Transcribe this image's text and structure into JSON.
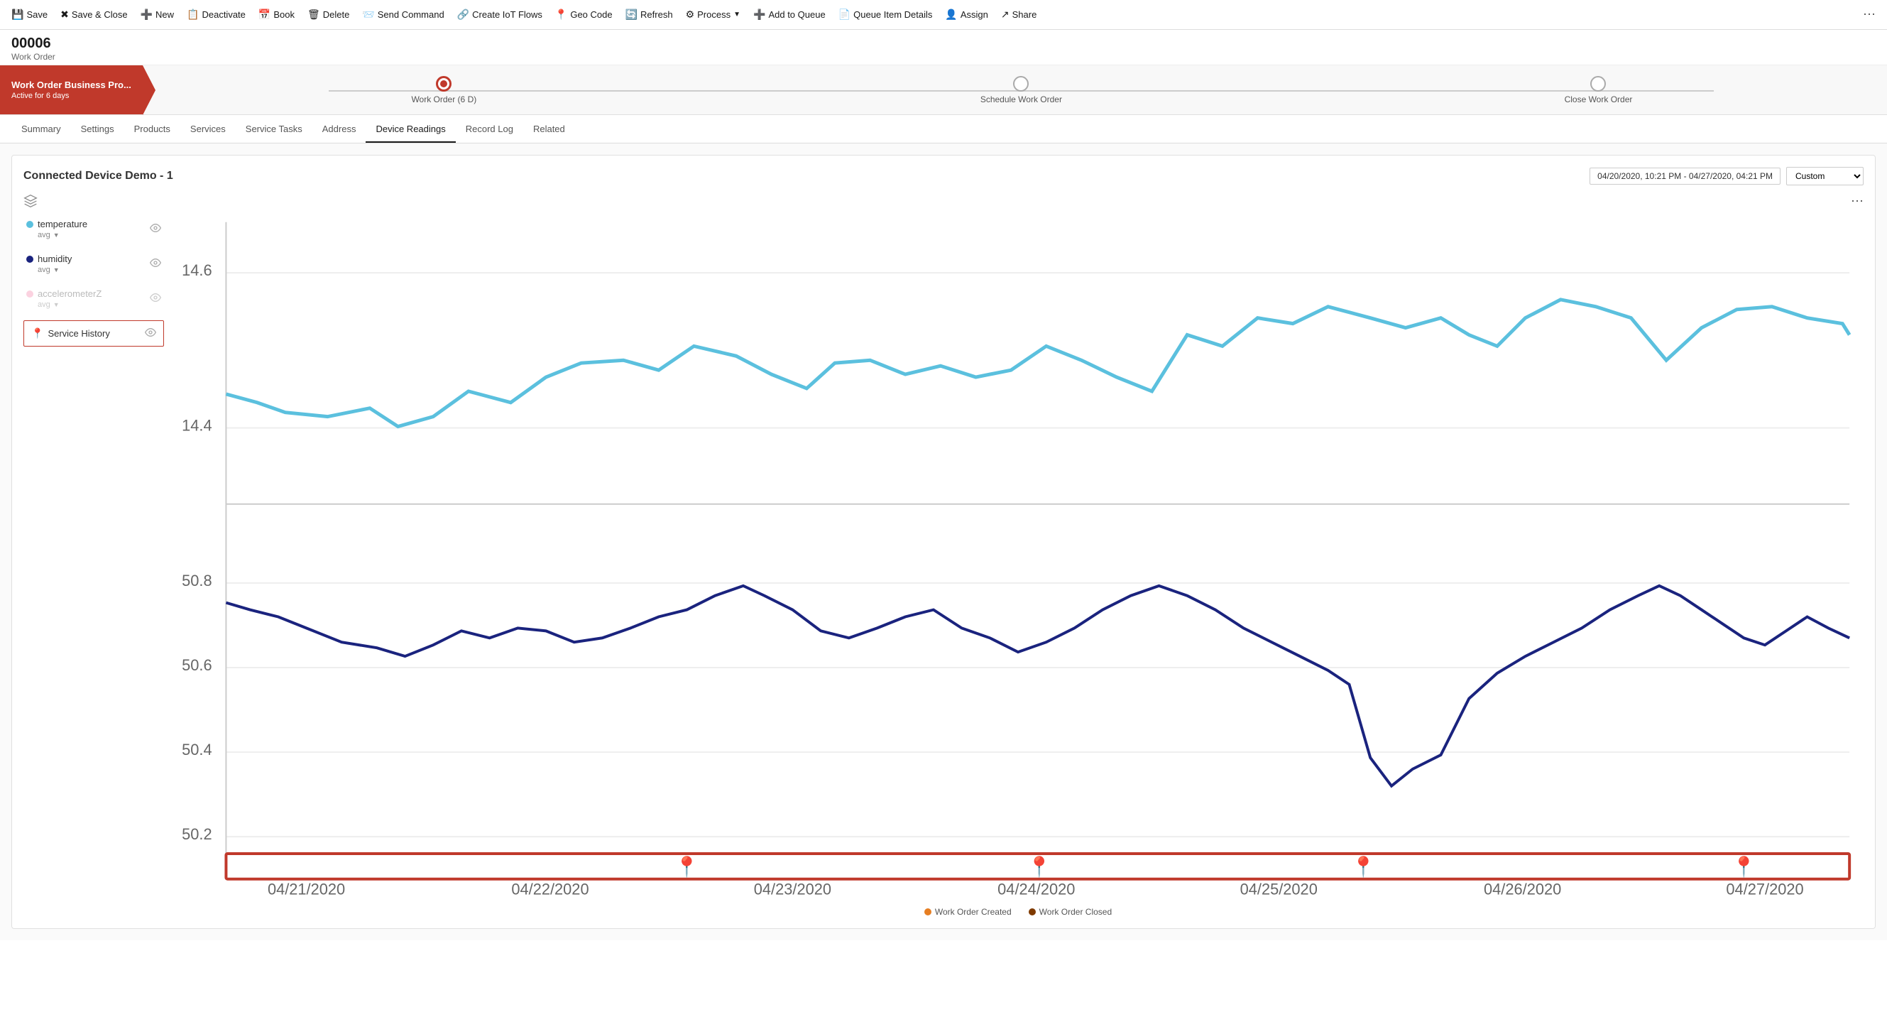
{
  "toolbar": {
    "save_label": "Save",
    "save_close_label": "Save & Close",
    "new_label": "New",
    "deactivate_label": "Deactivate",
    "book_label": "Book",
    "delete_label": "Delete",
    "send_command_label": "Send Command",
    "create_iot_flows_label": "Create IoT Flows",
    "geo_code_label": "Geo Code",
    "refresh_label": "Refresh",
    "process_label": "Process",
    "add_to_queue_label": "Add to Queue",
    "queue_item_details_label": "Queue Item Details",
    "assign_label": "Assign",
    "share_label": "Share"
  },
  "record": {
    "id": "00006",
    "type": "Work Order"
  },
  "stage": {
    "active_name": "Work Order Business Pro...",
    "active_sub": "Active for 6 days",
    "steps": [
      {
        "label": "Work Order (6 D)",
        "state": "active"
      },
      {
        "label": "Schedule Work Order",
        "state": "inactive"
      },
      {
        "label": "Close Work Order",
        "state": "inactive"
      }
    ]
  },
  "nav_tabs": {
    "tabs": [
      {
        "label": "Summary",
        "active": false
      },
      {
        "label": "Settings",
        "active": false
      },
      {
        "label": "Products",
        "active": false
      },
      {
        "label": "Services",
        "active": false
      },
      {
        "label": "Service Tasks",
        "active": false
      },
      {
        "label": "Address",
        "active": false
      },
      {
        "label": "Device Readings",
        "active": true
      },
      {
        "label": "Record Log",
        "active": false
      },
      {
        "label": "Related",
        "active": false
      }
    ]
  },
  "readings_card": {
    "title": "Connected Device Demo - 1",
    "date_range": "04/20/2020, 10:21 PM - 04/27/2020, 04:21 PM",
    "custom_option": "Custom",
    "legend_items": [
      {
        "id": "temperature",
        "label": "temperature",
        "sub": "avg",
        "color": "#5bc0de",
        "dimmed": false
      },
      {
        "id": "humidity",
        "label": "humidity",
        "sub": "avg",
        "color": "#1a237e",
        "dimmed": false
      },
      {
        "id": "accelerometerZ",
        "label": "accelerometerZ",
        "sub": "avg",
        "color": "#f48fb1",
        "dimmed": true
      }
    ],
    "service_history": {
      "label": "Service History",
      "icon_color": "#c0392b"
    },
    "bottom_legend": [
      {
        "label": "Work Order Created",
        "color": "#e67e22"
      },
      {
        "label": "Work Order Closed",
        "color": "#7f3a00"
      }
    ],
    "x_axis_labels": [
      "04/21/2020",
      "04/22/2020",
      "04/23/2020",
      "04/24/2020",
      "04/25/2020",
      "04/26/2020",
      "04/27/2020"
    ],
    "temp_y_labels": [
      "14.6",
      "14.4"
    ],
    "humidity_y_labels": [
      "50.8",
      "50.6",
      "50.4",
      "50.2"
    ]
  }
}
